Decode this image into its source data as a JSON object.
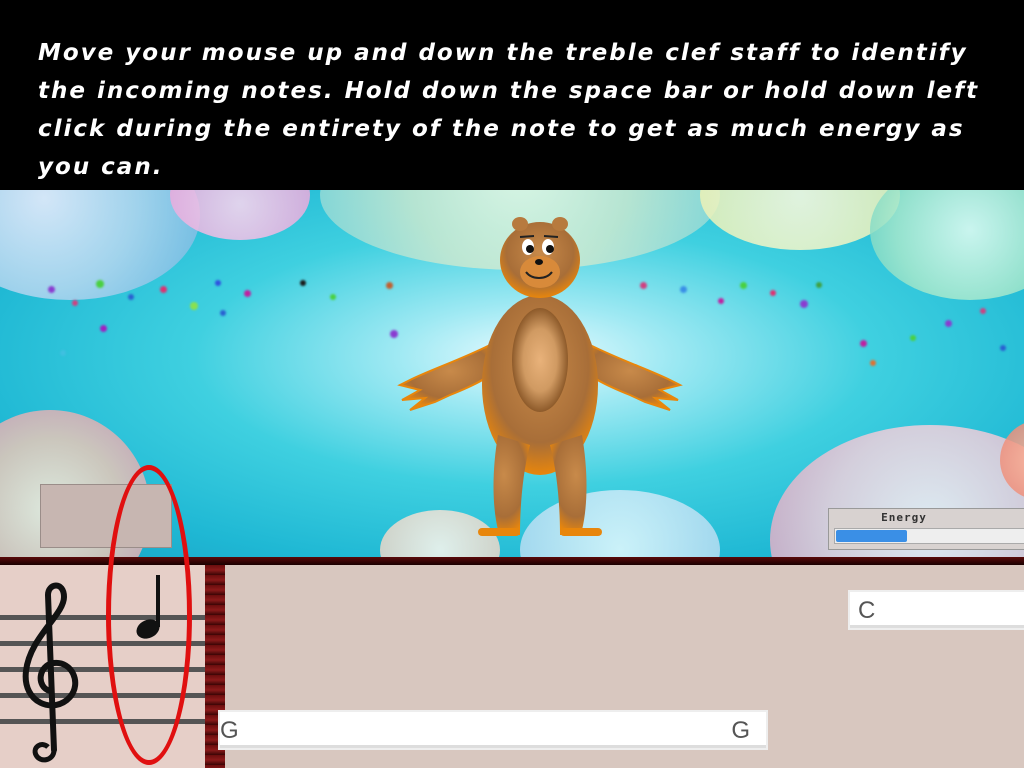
{
  "instructions": "Move your mouse up and down the treble clef staff to identify the incoming notes. Hold down the space bar or hold down left click during the entirety of the note to get as much energy as you can.",
  "energy": {
    "label": "Energy",
    "level_fraction": 0.38,
    "color": "#3a8fe6"
  },
  "answers": {
    "upper": "C",
    "lower_left": "G",
    "lower_right": "G"
  },
  "icons": {
    "clef": "treble-clef-icon",
    "note": "quarter-note-icon"
  },
  "colors": {
    "highlight_ring": "#e01010",
    "sky": "#1fb8d4",
    "bear": "#b77a3e"
  }
}
